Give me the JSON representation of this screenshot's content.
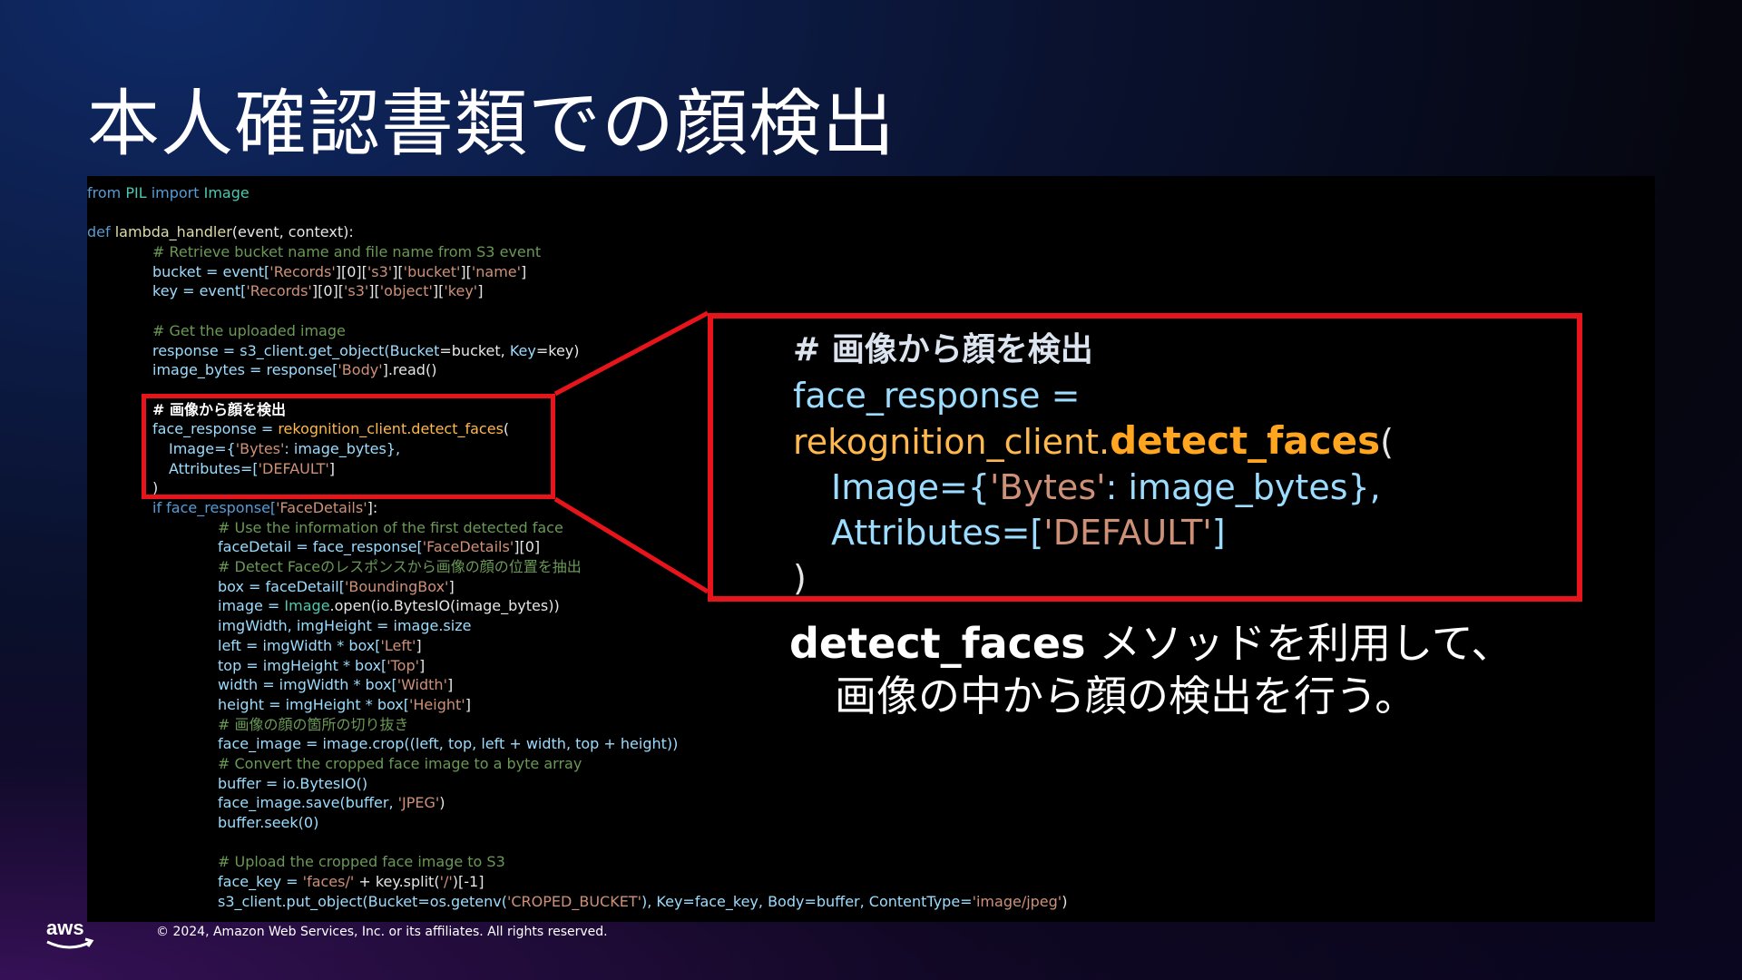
{
  "slide": {
    "title": "本人確認書類での顔検出",
    "caption_strong": "detect_faces",
    "caption_rest": " メソッドを利用して、",
    "caption_line2": "画像の中から顔の検出を行う。",
    "footer": "© 2024, Amazon Web Services, Inc. or its affiliates. All rights reserved.",
    "logo_text": "aws"
  },
  "code": {
    "l01_kw": "from",
    "l01_mod": " PIL ",
    "l01_kw2": "import",
    "l01_mod2": " Image",
    "l03_kw": "def",
    "l03_fn": " lambda_handler",
    "l03_rest": "(event, context):",
    "l04": "# Retrieve bucket name and file name from S3 event",
    "l05_a": "bucket = event[",
    "l05_s1": "'Records'",
    "l05_b": "][0][",
    "l05_s2": "'s3'",
    "l05_c": "][",
    "l05_s3": "'bucket'",
    "l05_d": "][",
    "l05_s4": "'name'",
    "l05_e": "]",
    "l06_a": "key = event[",
    "l06_s1": "'Records'",
    "l06_b": "][0][",
    "l06_s2": "'s3'",
    "l06_c": "][",
    "l06_s3": "'object'",
    "l06_d": "][",
    "l06_s4": "'key'",
    "l06_e": "]",
    "l08": "# Get the uploaded image",
    "l09_a": "response = s3_client.get_object(",
    "l09_b": "Bucket",
    "l09_c": "=bucket, ",
    "l09_d": "Key",
    "l09_e": "=key)",
    "l10_a": "image_bytes = response[",
    "l10_s": "'Body'",
    "l10_b": "].read()",
    "l12": "# 画像から顔を検出",
    "l13_a": "face_response = ",
    "l13_fn": "rekognition_client.detect_faces",
    "l13_b": "(",
    "l14_a": "Image={",
    "l14_s": "'Bytes'",
    "l14_b": ": image_bytes},",
    "l15_a": "Attributes=[",
    "l15_s": "'DEFAULT'",
    "l15_b": "]",
    "l16": ")",
    "l17_a": "if face_response[",
    "l17_s": "'FaceDetails'",
    "l17_b": "]:",
    "l18": "# Use the information of the first detected face",
    "l19_a": "faceDetail = face_response[",
    "l19_s": "'FaceDetails'",
    "l19_b": "][0]",
    "l20": "# Detect Faceのレスポンスから画像の顔の位置を抽出",
    "l21_a": "box = faceDetail[",
    "l21_s": "'BoundingBox'",
    "l21_b": "]",
    "l22_a": "image = ",
    "l22_md": "Image",
    "l22_b": ".open(io.BytesIO(image_bytes))",
    "l23": "imgWidth, imgHeight = image.size",
    "l24_a": "left = imgWidth * box[",
    "l24_s": "'Left'",
    "l24_b": "]",
    "l25_a": "top = imgHeight * box[",
    "l25_s": "'Top'",
    "l25_b": "]",
    "l26_a": "width = imgWidth * box[",
    "l26_s": "'Width'",
    "l26_b": "]",
    "l27_a": "height = imgHeight * box[",
    "l27_s": "'Height'",
    "l27_b": "]",
    "l28": "# 画像の顔の箇所の切り抜き",
    "l29": "face_image = image.crop((left, top, left + width, top + height))",
    "l30": "# Convert the cropped face image to a byte array",
    "l31": "buffer = io.BytesIO()",
    "l32_a": "face_image.save(buffer, ",
    "l32_s": "'JPEG'",
    "l32_b": ")",
    "l33": "buffer.seek(0)",
    "l35": "# Upload the cropped face image to S3",
    "l36_a": "face_key = ",
    "l36_s1": "'faces/'",
    "l36_b": " + key.split(",
    "l36_s2": "'/'",
    "l36_c": ")[-1]",
    "l37_a": "s3_client.put_object(Bucket=os.getenv(",
    "l37_s1": "'CROPED_BUCKET'",
    "l37_b": "), Key=face_key, Body=buffer, ContentType=",
    "l37_s2": "'image/jpeg'",
    "l37_c": ")"
  },
  "zoom": {
    "comment": "# 画像から顔を検出",
    "line2": "face_response =",
    "line3_a": "rekognition_client.",
    "line3_b": "detect_faces",
    "line3_c": "(",
    "line4_a": "Image={",
    "line4_s": "'Bytes'",
    "line4_b": ": image_bytes},",
    "line5_a": "Attributes=[",
    "line5_s": "'DEFAULT'",
    "line5_b": "]",
    "line6": ")"
  },
  "colors": {
    "highlight_border": "#e8141c",
    "code_background": "#000000",
    "method_highlight": "#ffa51f"
  }
}
